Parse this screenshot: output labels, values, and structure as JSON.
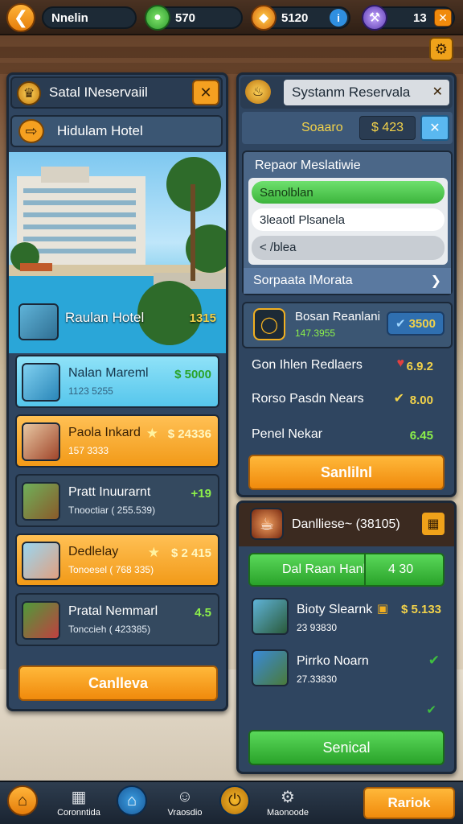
{
  "topbar": {
    "player_name": "Nnelin",
    "coins": "570",
    "gems": "5120",
    "energy": "13"
  },
  "left_panel": {
    "title": "Satal INeservaiil",
    "hotel_header": "Hidulam Hotel",
    "featured": {
      "name": "Raulan Hotel",
      "price": "1315"
    },
    "rows": [
      {
        "title": "Nalan Mareml",
        "sub": "1123 5255",
        "price": "$ 5000"
      },
      {
        "title": "Paola Inkard",
        "sub": "157 3333",
        "price": "$ 24336"
      },
      {
        "title": "Pratt Inuurarnt",
        "sub": "Tnooctiar ( 255.539)",
        "price": "+19"
      },
      {
        "title": "Dedlelay",
        "sub": "Tonoesel ( 768 335)",
        "price": "$ 2 415"
      },
      {
        "title": "Pratal Nemmarl",
        "sub": "Tonccieh ( 423385)",
        "price": "4.5"
      }
    ],
    "action_label": "Canlleva"
  },
  "right_panel": {
    "title": "Systanm Reservala",
    "sub_label": "Soaaro",
    "sub_value": "$ 423",
    "section_title": "Repaor Meslatiwie",
    "options": [
      "Sanolblan",
      "3leaotl Plsanela",
      "< /blea"
    ],
    "selector_label": "Sorpaata IMorata",
    "detail": {
      "title": "Bosan Reanlani",
      "sub": "147.3955",
      "badge": "3500"
    },
    "lines": [
      {
        "label": "Gon Ihlen Redlaers",
        "value": "6.9.2"
      },
      {
        "label": "Rorso Pasdn Nears",
        "value": "8.00"
      },
      {
        "label": "Penel Nekar",
        "value": "6.45"
      }
    ],
    "action_label": "Sanlilnl"
  },
  "bottom_panel": {
    "title": "Danlliese~ (38105)",
    "bar_label": "Dal Raan Hanl",
    "bar_value": "4 30",
    "items": [
      {
        "title": "Bioty Slearnk",
        "sub": "23 93830",
        "price": "$ 5.133"
      },
      {
        "title": "Pirrko Noarn",
        "sub": "27.33830",
        "price": ""
      }
    ],
    "action_label": "Senical"
  },
  "navbar": {
    "items": [
      "",
      "Coronntida",
      "",
      "Vraosdio",
      "",
      "Maonoode"
    ],
    "back_label": "Rariok"
  },
  "colors": {
    "accent_orange": "#f5a020",
    "accent_green": "#3fbf3f",
    "panel_blue": "#2f4560",
    "price_green": "#8cf04a",
    "price_gold": "#f2d24a"
  }
}
